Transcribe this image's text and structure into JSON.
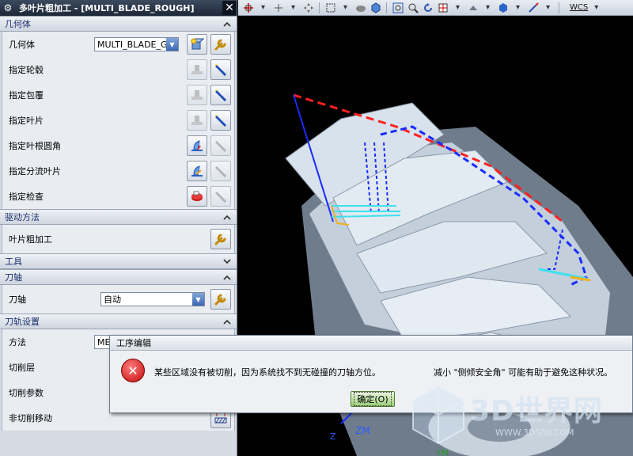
{
  "window": {
    "title": "多叶片粗加工 - [MULTI_BLADE_ROUGH]",
    "close_glyph": "✕"
  },
  "geometry": {
    "header": "几何体",
    "geometry_label": "几何体",
    "geometry_value": "MULTI_BLADE_G",
    "rows": [
      {
        "label": "指定轮毂"
      },
      {
        "label": "指定包覆"
      },
      {
        "label": "指定叶片"
      },
      {
        "label": "指定叶根圆角"
      },
      {
        "label": "指定分流叶片"
      },
      {
        "label": "指定检查"
      }
    ]
  },
  "drive": {
    "header": "驱动方法",
    "label": "叶片粗加工"
  },
  "tool": {
    "header": "工具"
  },
  "axis": {
    "header": "刀轴",
    "label": "刀轴",
    "value": "自动"
  },
  "path": {
    "header": "刀轨设置",
    "method_label": "方法",
    "method_value": "ME",
    "rows": [
      {
        "label": "切削层"
      },
      {
        "label": "切削参数"
      },
      {
        "label": "非切削移动"
      }
    ]
  },
  "toolbar": {
    "wcs": "WCS"
  },
  "viewport": {
    "axis_label": "ZM",
    "axis_label2": "Z",
    "axis_label3": "YM"
  },
  "dialog": {
    "title": "工序编辑",
    "message": "某些区域没有被切削，因为系统找不到无碰撞的刀轴方位。",
    "hint": "减小 \"侧倾安全角\" 可能有助于避免这种状况。",
    "ok_label": "确定(O)"
  },
  "watermark": {
    "text": "3D世界网",
    "url": "WWW.3DSJW.COM"
  },
  "colors": {
    "section_text": "#1a2e6e",
    "tool_path_red": "#ff2020",
    "tool_path_blue": "#1a2cff",
    "error_red": "#c40a0a",
    "ok_green": "#9ccf7a"
  }
}
